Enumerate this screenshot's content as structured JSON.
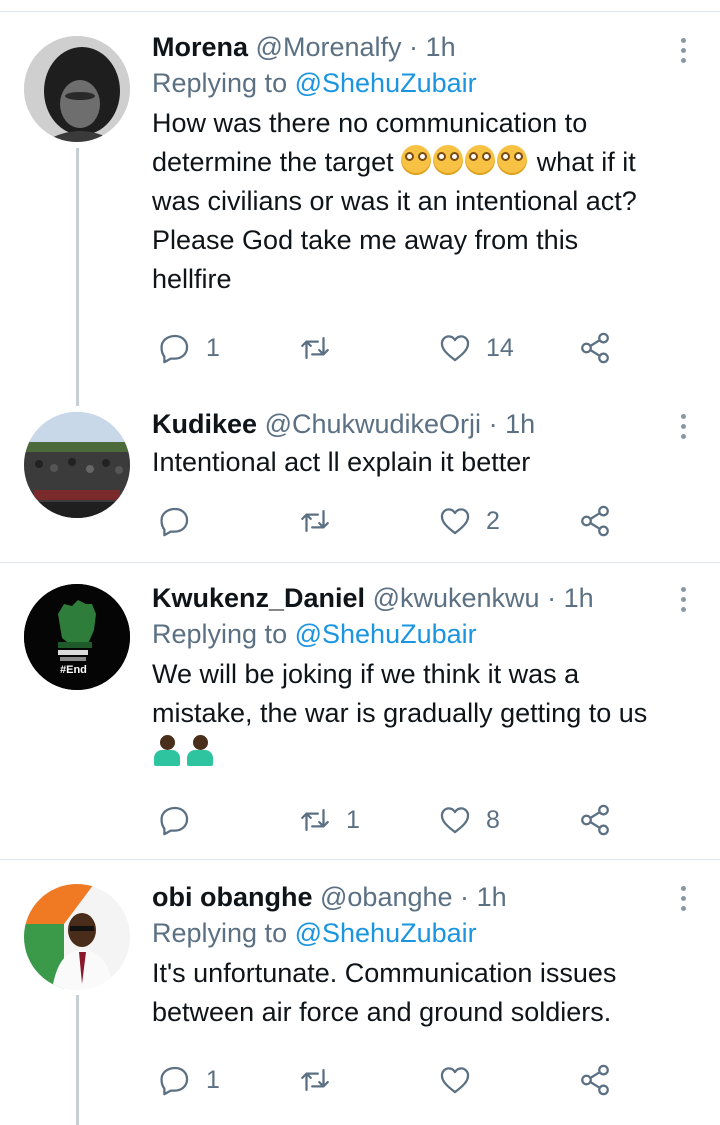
{
  "tweets": [
    {
      "name": "Morena",
      "handle": "@Morenalfy",
      "separator": "·",
      "time": "1h",
      "replying_prefix": "Replying to",
      "replying_to": "@ShehuZubair",
      "text_before": "How was there no communication to determine the target",
      "emoji": "😳😳😳😳",
      "text_after": "what  if it was civilians or was it an intentional act? Please God take me away from this hellfire",
      "replies": "1",
      "retweets": "",
      "likes": "14"
    },
    {
      "name": "Kudikee",
      "handle": "@ChukwudikeOrji",
      "separator": "·",
      "time": "1h",
      "text": "Intentional act ll explain it better",
      "replies": "",
      "retweets": "",
      "likes": "2"
    },
    {
      "name": "Kwukenz_Daniel",
      "handle": "@kwukenkwu",
      "separator": "·",
      "time": "1h",
      "replying_prefix": "Replying to",
      "replying_to": "@ShehuZubair",
      "text": "We will be joking if we think it was a mistake, the war is gradually getting to us",
      "emoji": "🤷🏿‍♂️🤷🏿‍♂️",
      "avatar_text": "#End",
      "replies": "",
      "retweets": "1",
      "likes": "8"
    },
    {
      "name": "obi obanghe",
      "handle": "@obanghe",
      "separator": "·",
      "time": "1h",
      "replying_prefix": "Replying to",
      "replying_to": "@ShehuZubair",
      "text": "It's unfortunate. Communication issues between air force and ground soldiers.",
      "replies": "1",
      "retweets": "",
      "likes": ""
    }
  ],
  "icons": [
    "reply-icon",
    "retweet-icon",
    "like-icon",
    "share-icon",
    "more-icon"
  ],
  "colors": {
    "link": "#1b95e0",
    "muted": "#5b7083",
    "text": "#0f1419",
    "divider": "#e1e6ea",
    "thread_line": "#c4cfd6"
  }
}
